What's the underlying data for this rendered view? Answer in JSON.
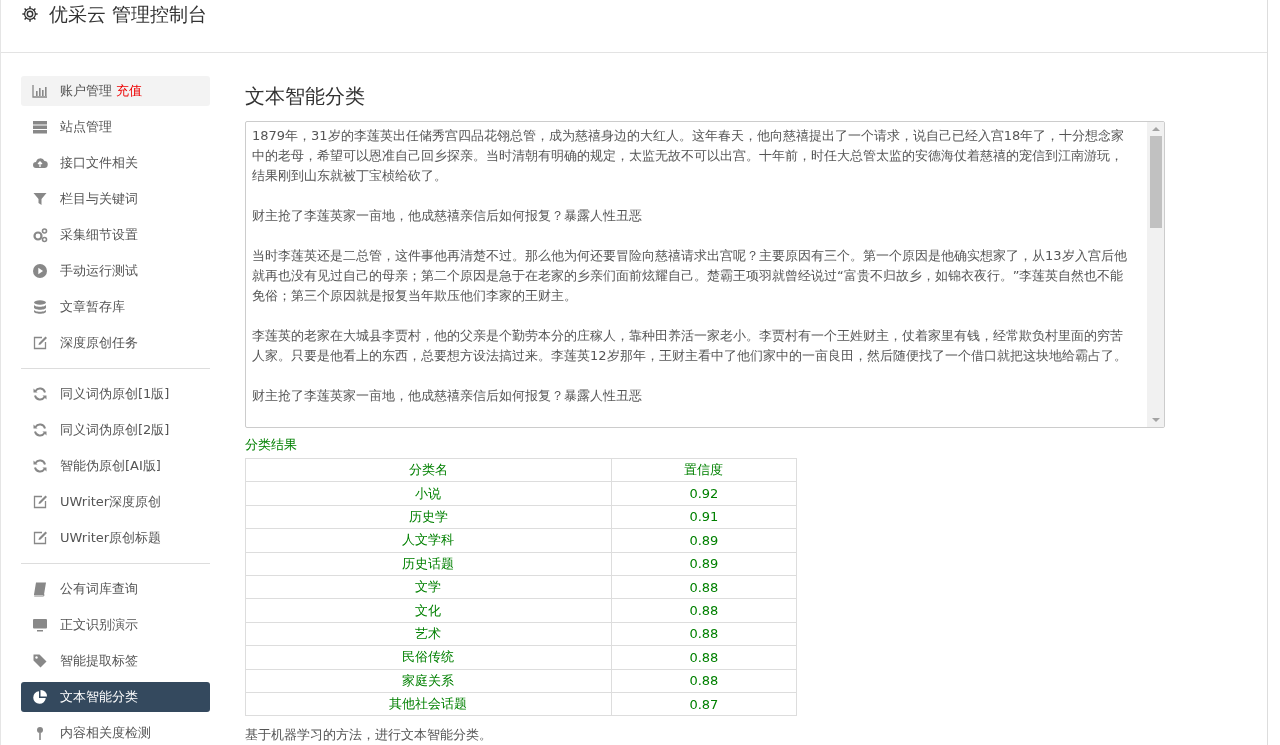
{
  "header": {
    "title": "优采云 管理控制台"
  },
  "sidebar": {
    "groups": [
      {
        "items": [
          {
            "label": "账户管理",
            "badge": "充值",
            "selected": false,
            "highlighted": true
          },
          {
            "label": "站点管理",
            "selected": false,
            "highlighted": false
          },
          {
            "label": "接口文件相关",
            "selected": false,
            "highlighted": false
          },
          {
            "label": "栏目与关键词",
            "selected": false,
            "highlighted": false
          },
          {
            "label": "采集细节设置",
            "selected": false,
            "highlighted": false
          },
          {
            "label": "手动运行测试",
            "selected": false,
            "highlighted": false
          },
          {
            "label": "文章暂存库",
            "selected": false,
            "highlighted": false
          },
          {
            "label": "深度原创任务",
            "selected": false,
            "highlighted": false
          }
        ]
      },
      {
        "items": [
          {
            "label": "同义词伪原创[1版]",
            "selected": false,
            "highlighted": false
          },
          {
            "label": "同义词伪原创[2版]",
            "selected": false,
            "highlighted": false
          },
          {
            "label": "智能伪原创[AI版]",
            "selected": false,
            "highlighted": false
          },
          {
            "label": "UWriter深度原创",
            "selected": false,
            "highlighted": false
          },
          {
            "label": "UWriter原创标题",
            "selected": false,
            "highlighted": false
          }
        ]
      },
      {
        "items": [
          {
            "label": "公有词库查询",
            "selected": false,
            "highlighted": false
          },
          {
            "label": "正文识别演示",
            "selected": false,
            "highlighted": false
          },
          {
            "label": "智能提取标签",
            "selected": false,
            "highlighted": false
          },
          {
            "label": "文本智能分类",
            "selected": true,
            "highlighted": false
          },
          {
            "label": "内容相关度检测",
            "selected": false,
            "highlighted": false
          }
        ]
      }
    ]
  },
  "main": {
    "title": "文本智能分类",
    "text_field": {
      "paragraphs": [
        "1879年，31岁的李莲英出任储秀宫四品花翎总管，成为慈禧身边的大红人。这年春天，他向慈禧提出了一个请求，说自己已经入宫18年了，十分想念家中的老母，希望可以恩准自己回乡探亲。当时清朝有明确的规定，太监无故不可以出宫。十年前，时任大总管太监的安德海仗着慈禧的宠信到江南游玩，结果刚到山东就被丁宝桢给砍了。",
        "财主抢了李莲英家一亩地，他成慈禧亲信后如何报复？暴露人性丑恶",
        "当时李莲英还是二总管，这件事他再清楚不过。那么他为何还要冒险向慈禧请求出宫呢？主要原因有三个。第一个原因是他确实想家了，从13岁入宫后他就再也没有见过自己的母亲；第二个原因是急于在老家的乡亲们面前炫耀自己。楚霸王项羽就曾经说过“富贵不归故乡，如锦衣夜行。”李莲英自然也不能免俗；第三个原因就是报复当年欺压他们李家的王财主。",
        "李莲英的老家在大城县李贾村，他的父亲是个勤劳本分的庄稼人，靠种田养活一家老小。李贾村有一个王姓财主，仗着家里有钱，经常欺负村里面的穷苦人家。只要是他看上的东西，总要想方设法搞过来。李莲英12岁那年，王财主看中了他们家中的一亩良田，然后随便找了一个借口就把这块地给霸占了。",
        "财主抢了李莲英家一亩地，他成慈禧亲信后如何报复？暴露人性丑恶"
      ]
    },
    "result_label": "分类结果",
    "table": {
      "columns": [
        "分类名",
        "置信度"
      ],
      "rows": [
        [
          "小说",
          "0.92"
        ],
        [
          "历史学",
          "0.91"
        ],
        [
          "人文学科",
          "0.89"
        ],
        [
          "历史话题",
          "0.89"
        ],
        [
          "文学",
          "0.88"
        ],
        [
          "文化",
          "0.88"
        ],
        [
          "艺术",
          "0.88"
        ],
        [
          "民俗传统",
          "0.88"
        ],
        [
          "家庭关系",
          "0.88"
        ],
        [
          "其他社会话题",
          "0.87"
        ]
      ]
    },
    "note": "基于机器学习的方法，进行文本智能分类。"
  }
}
